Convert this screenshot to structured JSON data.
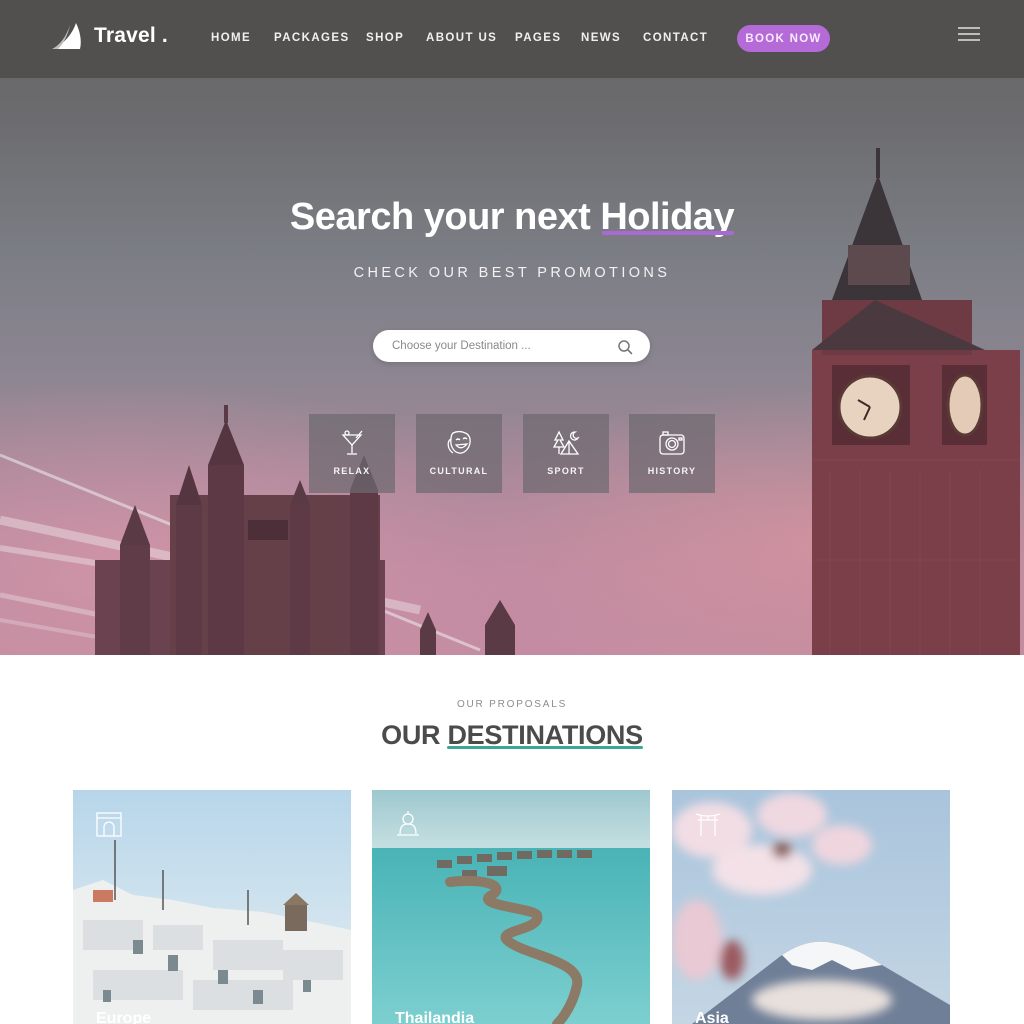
{
  "brand": {
    "name": "Travel",
    "dot": "."
  },
  "nav": {
    "items": [
      {
        "label": "HOME"
      },
      {
        "label": "PACKAGES"
      },
      {
        "label": "SHOP"
      },
      {
        "label": "ABOUT US"
      },
      {
        "label": "PAGES"
      },
      {
        "label": "NEWS"
      },
      {
        "label": "CONTACT"
      }
    ],
    "cta_label": "BOOK NOW",
    "menu_icon": "hamburger-icon"
  },
  "hero": {
    "title_prefix": "Search your next",
    "title_highlight": "Holiday",
    "subtitle": "CHECK OUR BEST PROMOTIONS",
    "search": {
      "placeholder": "Choose your Destination ...",
      "value": "",
      "icon": "search-icon"
    },
    "categories": [
      {
        "label": "RELAX",
        "icon": "cocktail-icon"
      },
      {
        "label": "CULTURAL",
        "icon": "theater-mask-icon"
      },
      {
        "label": "SPORT",
        "icon": "camping-tent-icon"
      },
      {
        "label": "HISTORY",
        "icon": "camera-icon"
      }
    ]
  },
  "destinations": {
    "kicker": "OUR PROPOSALS",
    "title_prefix": "OUR",
    "title_highlight": "DESTINATIONS",
    "cards": [
      {
        "label": "Europe",
        "icon": "arc-de-triomphe-icon"
      },
      {
        "label": "Thailandia",
        "icon": "buddha-icon"
      },
      {
        "label": "Asia",
        "icon": "torii-gate-icon"
      }
    ]
  },
  "colors": {
    "accent_purple": "#b46bd8",
    "accent_teal": "#3ba894",
    "navbar": "#504e4c",
    "heading": "#4b4b4b"
  }
}
